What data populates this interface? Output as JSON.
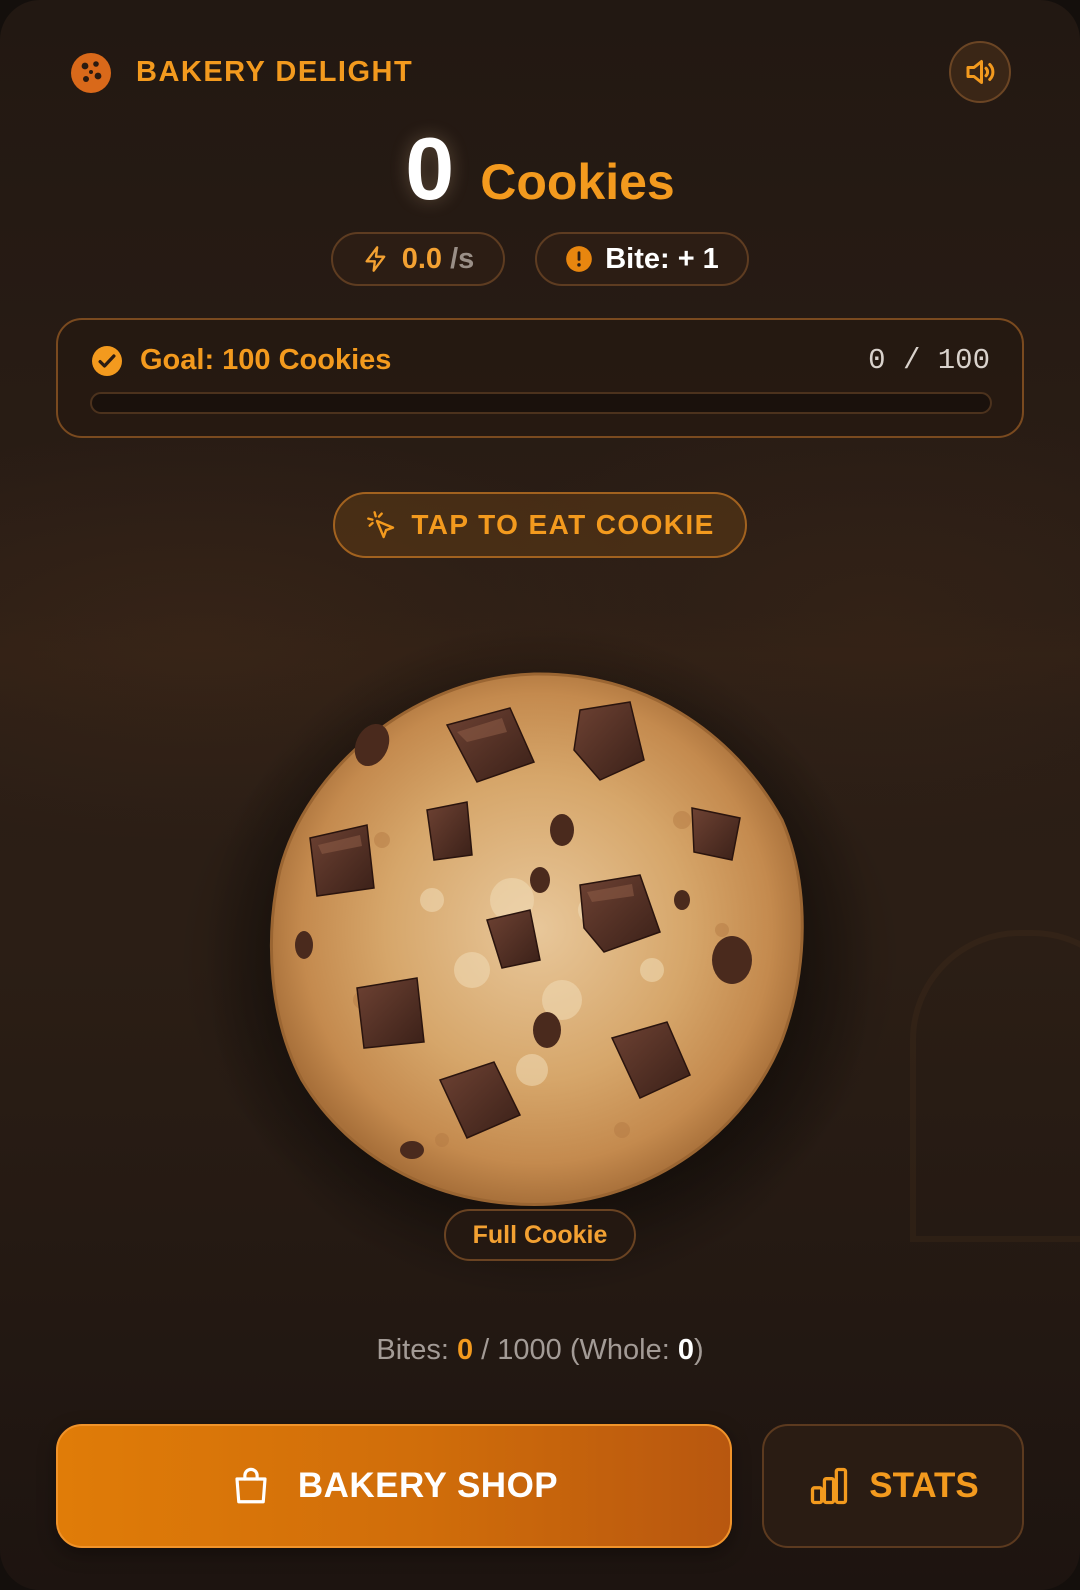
{
  "header": {
    "title": "BAKERY DELIGHT",
    "logo_icon": "cookie-icon",
    "sound_icon": "speaker-icon"
  },
  "counter": {
    "value": "0",
    "unit": "Cookies"
  },
  "stats_pills": {
    "rate_value": "0.0",
    "rate_unit": "/s",
    "rate_icon": "lightning-icon",
    "bite_label": "Bite: + 1",
    "bite_icon": "alert-circle-icon"
  },
  "goal": {
    "label": "Goal: 100 Cookies",
    "count": "0 / 100",
    "progress": 0,
    "icon": "check-circle-icon"
  },
  "tap_hint": {
    "label": "TAP TO EAT COOKIE",
    "icon": "tap-cursor-icon"
  },
  "cookie": {
    "state_label": "Full Cookie"
  },
  "bites": {
    "prefix": "Bites:",
    "current": "0",
    "total_text": "/ 1000 (Whole:",
    "whole": "0",
    "suffix": ")"
  },
  "buttons": {
    "shop_label": "BAKERY SHOP",
    "shop_icon": "shopping-bag-icon",
    "stats_label": "STATS",
    "stats_icon": "bar-chart-icon"
  },
  "colors": {
    "accent": "#f39a1e",
    "background": "#221812",
    "shop_button": "#e07c08"
  }
}
